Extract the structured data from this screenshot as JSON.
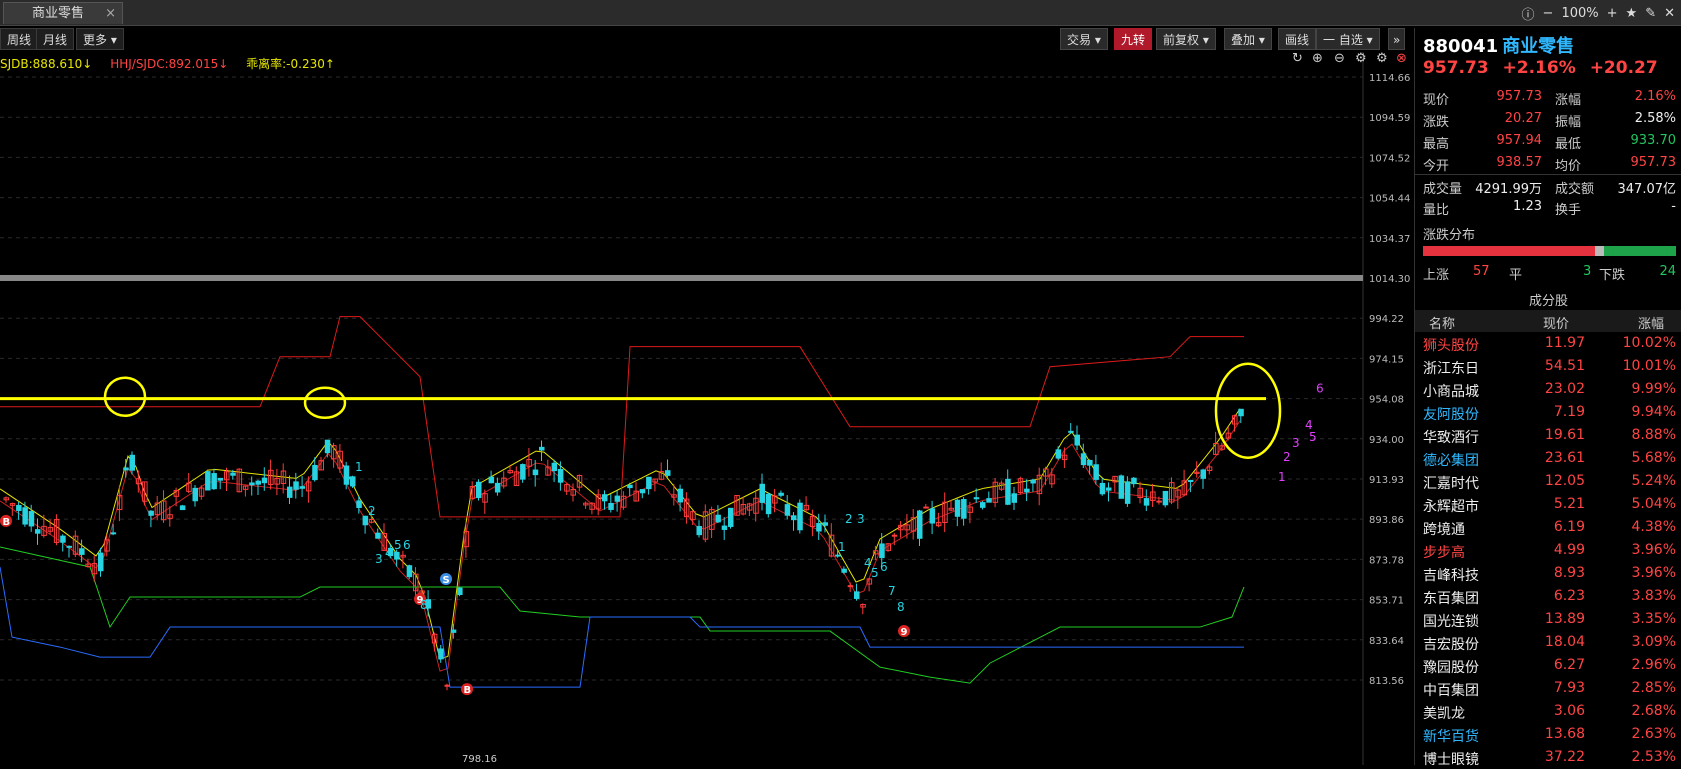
{
  "tab": {
    "title": "商业零售",
    "close": "×"
  },
  "top_right": {
    "zoom": "100%",
    "icons": [
      "info-icon",
      "minus-icon",
      "plus-icon",
      "star-icon",
      "edit-icon",
      "close-icon"
    ]
  },
  "toolbar_left": [
    "周线",
    "月线",
    "更多 ▾"
  ],
  "toolbar_right": [
    "交易 ▾",
    "九转",
    "前复权 ▾",
    "叠加 ▾",
    "画线",
    "一 自选 ▾"
  ],
  "indicators": {
    "sjdb": "SJDB:888.610↓",
    "hhj": "HHJ/SJDC:892.015↓",
    "deviation": "乖离率:-0.230↑"
  },
  "chart_data": {
    "type": "candlestick",
    "y_ticks": [
      "1114.66",
      "1094.59",
      "1074.52",
      "1054.44",
      "1034.37",
      "1014.30",
      "994.22",
      "974.15",
      "954.08",
      "934.00",
      "913.93",
      "893.86",
      "873.78",
      "853.71",
      "833.64",
      "813.56"
    ],
    "ylim": [
      798.16,
      1114.66
    ],
    "low_label": "798.16",
    "horizontal_line": 954.08,
    "markers": [
      "B",
      "9",
      "S",
      "B",
      "9"
    ],
    "td_counts": [
      "1",
      "2",
      "3",
      "4",
      "5",
      "6",
      "8",
      "1",
      "2",
      "3",
      "4",
      "5",
      "6",
      "7",
      "8",
      "1",
      "2",
      "3",
      "4",
      "5",
      "6"
    ]
  },
  "panel": {
    "code": "880041",
    "name": "商业零售",
    "price": "957.73",
    "pct": "+2.16%",
    "chg": "+20.27",
    "rows": [
      {
        "k1": "现价",
        "v1": "957.73",
        "c1": "red",
        "k2": "涨幅",
        "v2": "2.16%",
        "c2": "red"
      },
      {
        "k1": "涨跌",
        "v1": "20.27",
        "c1": "red",
        "k2": "振幅",
        "v2": "2.58%",
        "c2": "wht"
      },
      {
        "k1": "最高",
        "v1": "957.94",
        "c1": "red",
        "k2": "最低",
        "v2": "933.70",
        "c2": "grn"
      },
      {
        "k1": "今开",
        "v1": "938.57",
        "c1": "red",
        "k2": "均价",
        "v2": "957.73",
        "c2": "red"
      },
      {
        "k1": "成交量",
        "v1": "4291.99万",
        "c1": "wht",
        "k2": "成交额",
        "v2": "347.07亿",
        "c2": "wht"
      },
      {
        "k1": "量比",
        "v1": "1.23",
        "c1": "wht",
        "k2": "换手",
        "v2": "-",
        "c2": "wht"
      }
    ],
    "dist_title": "涨跌分布",
    "up_label": "上涨",
    "up": 57,
    "flat_label": "平",
    "flat": 3,
    "down_label": "下跌",
    "down": 24,
    "comp_title": "成分股",
    "comp_head": [
      "名称",
      "现价",
      "涨幅"
    ],
    "stocks": [
      {
        "name": "狮头股份",
        "price": "11.97",
        "chg": "10.02%",
        "color": "#ff4444"
      },
      {
        "name": "浙江东日",
        "price": "54.51",
        "chg": "10.01%",
        "color": "#eeeeee"
      },
      {
        "name": "小商品城",
        "price": "23.02",
        "chg": "9.99%",
        "color": "#eeeeee"
      },
      {
        "name": "友阿股份",
        "price": "7.19",
        "chg": "9.94%",
        "color": "#2fb8ff"
      },
      {
        "name": "华致酒行",
        "price": "19.61",
        "chg": "8.88%",
        "color": "#eeeeee"
      },
      {
        "name": "德必集团",
        "price": "23.61",
        "chg": "5.68%",
        "color": "#2fb8ff"
      },
      {
        "name": "汇嘉时代",
        "price": "12.05",
        "chg": "5.24%",
        "color": "#eeeeee"
      },
      {
        "name": "永辉超市",
        "price": "5.21",
        "chg": "5.04%",
        "color": "#eeeeee"
      },
      {
        "name": "跨境通",
        "price": "6.19",
        "chg": "4.38%",
        "color": "#eeeeee"
      },
      {
        "name": "步步高",
        "price": "4.99",
        "chg": "3.96%",
        "color": "#ff4444"
      },
      {
        "name": "吉峰科技",
        "price": "8.93",
        "chg": "3.96%",
        "color": "#eeeeee"
      },
      {
        "name": "东百集团",
        "price": "6.23",
        "chg": "3.83%",
        "color": "#eeeeee"
      },
      {
        "name": "国光连锁",
        "price": "13.89",
        "chg": "3.35%",
        "color": "#eeeeee"
      },
      {
        "name": "吉宏股份",
        "price": "18.04",
        "chg": "3.09%",
        "color": "#eeeeee"
      },
      {
        "name": "豫园股份",
        "price": "6.27",
        "chg": "2.96%",
        "color": "#eeeeee"
      },
      {
        "name": "中百集团",
        "price": "7.93",
        "chg": "2.85%",
        "color": "#eeeeee"
      },
      {
        "name": "美凯龙",
        "price": "3.06",
        "chg": "2.68%",
        "color": "#eeeeee"
      },
      {
        "name": "新华百货",
        "price": "13.68",
        "chg": "2.63%",
        "color": "#2fb8ff"
      },
      {
        "name": "博士眼镜",
        "price": "37.22",
        "chg": "2.53%",
        "color": "#eeeeee"
      }
    ]
  }
}
